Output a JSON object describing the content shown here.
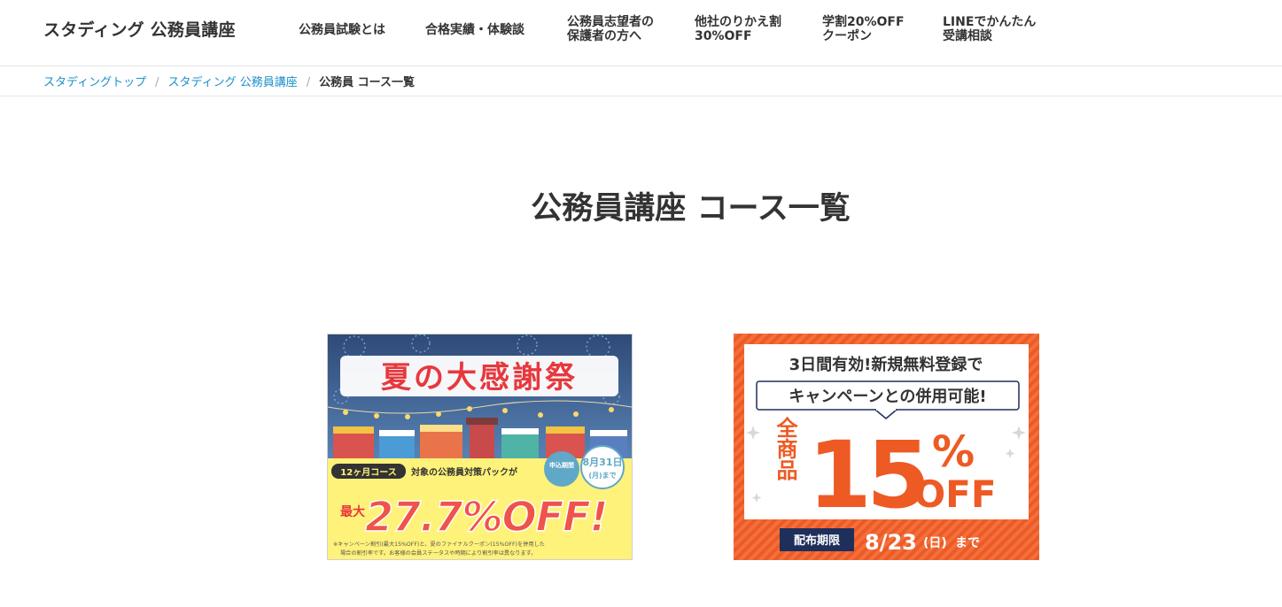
{
  "header": {
    "logo": "スタディング 公務員講座",
    "nav": [
      {
        "line1": "公務員試験とは",
        "line2": ""
      },
      {
        "line1": "合格実績・体験談",
        "line2": ""
      },
      {
        "line1": "公務員志望者の",
        "line2": "保護者の方へ"
      },
      {
        "line1": "他社のりかえ割",
        "line2": "30%OFF"
      },
      {
        "line1": "学割20%OFF",
        "line2": "クーポン"
      },
      {
        "line1": "LINEでかんたん",
        "line2": "受講相談"
      }
    ]
  },
  "breadcrumb": {
    "items": [
      "スタディングトップ",
      "スタディング 公務員講座"
    ],
    "separator": "/",
    "current": "公務員 コース一覧"
  },
  "page_title": "公務員講座 コース一覧",
  "banners": {
    "summer": {
      "title": "夏の大感謝祭",
      "course_tag": "12ヶ月コース",
      "target_text": "対象の公務員対策パックが",
      "deadline_label": "申込期間",
      "deadline_date": "8月31日",
      "deadline_suffix": "(月)まで",
      "max_label": "最大",
      "discount": "27.7%OFF!",
      "note_line1": "※キャンペーン割引(最大15%OFF)と、夏のファイナルクーポン(15%OFF)を併用した",
      "note_line2": "場合の割引率です。お客様の会員ステータスや時期により割引率は異なります。",
      "colors": {
        "sky": "#3c5a8a",
        "title_red": "#e8383d",
        "yellow": "#fff27a",
        "off_red": "#f0534a"
      }
    },
    "signup": {
      "headline": "3日間有効!新規無料登録で",
      "subheadline": "キャンペーンとの併用可能!",
      "all_items": "全商品",
      "percent": "15",
      "percent_sign": "%",
      "off": "OFF",
      "period_label": "配布期限",
      "period_date": "8/23",
      "period_day": "(日)",
      "period_suffix": "まで",
      "colors": {
        "orange": "#ee5a24",
        "navy": "#1f2f5c"
      }
    }
  }
}
